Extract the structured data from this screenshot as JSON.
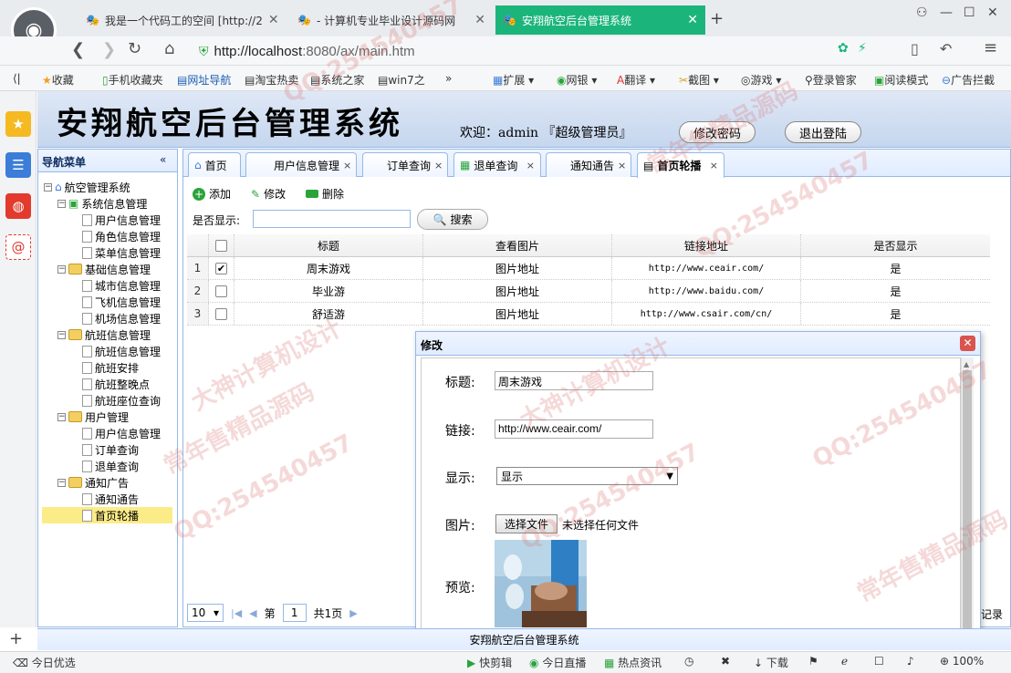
{
  "browser": {
    "tabs": [
      {
        "label": "我是一个代码工的空间 [http://2",
        "active": false
      },
      {
        "label": "- 计算机专业毕业设计源码网",
        "active": false
      },
      {
        "label": "安翔航空后台管理系统",
        "active": true
      }
    ],
    "new_tab": "+",
    "url_host": "http://localhost",
    "url_rest": ":8080/ax/main.htm",
    "bookmarks": [
      "收藏",
      "手机收藏夹",
      "网址导航",
      "淘宝热卖",
      "系统之家",
      "win7之",
      "扩展",
      "网银",
      "翻译",
      "截图",
      "游戏",
      "登录管家",
      "阅读模式",
      "广告拦截"
    ]
  },
  "app": {
    "title": "安翔航空后台管理系统",
    "welcome": "欢迎：admin 『超级管理员』",
    "change_password": "修改密码",
    "logout": "退出登陆",
    "footer": "安翔航空后台管理系统"
  },
  "nav": {
    "header": "导航菜单",
    "collapse": "«",
    "tree": [
      {
        "label": "航空管理系统",
        "level": 0,
        "type": "root"
      },
      {
        "label": "系统信息管理",
        "level": 1,
        "type": "group"
      },
      {
        "label": "用户信息管理",
        "level": 2,
        "type": "leaf"
      },
      {
        "label": "角色信息管理",
        "level": 2,
        "type": "leaf"
      },
      {
        "label": "菜单信息管理",
        "level": 2,
        "type": "leaf"
      },
      {
        "label": "基础信息管理",
        "level": 1,
        "type": "folder"
      },
      {
        "label": "城市信息管理",
        "level": 2,
        "type": "leaf"
      },
      {
        "label": "飞机信息管理",
        "level": 2,
        "type": "leaf"
      },
      {
        "label": "机场信息管理",
        "level": 2,
        "type": "leaf"
      },
      {
        "label": "航班信息管理",
        "level": 1,
        "type": "folder"
      },
      {
        "label": "航班信息管理",
        "level": 2,
        "type": "leaf"
      },
      {
        "label": "航班安排",
        "level": 2,
        "type": "leaf"
      },
      {
        "label": "航班整晚点",
        "level": 2,
        "type": "leaf"
      },
      {
        "label": "航班座位查询",
        "level": 2,
        "type": "leaf"
      },
      {
        "label": "用户管理",
        "level": 1,
        "type": "folder"
      },
      {
        "label": "用户信息管理",
        "level": 2,
        "type": "leaf"
      },
      {
        "label": "订单查询",
        "level": 2,
        "type": "leaf"
      },
      {
        "label": "退单查询",
        "level": 2,
        "type": "leaf"
      },
      {
        "label": "通知广告",
        "level": 1,
        "type": "folder"
      },
      {
        "label": "通知通告",
        "level": 2,
        "type": "leaf"
      },
      {
        "label": "首页轮播",
        "level": 2,
        "type": "leaf",
        "selected": true
      }
    ]
  },
  "page_tabs": [
    {
      "label": "首页",
      "closable": false
    },
    {
      "label": "用户信息管理",
      "closable": true
    },
    {
      "label": "订单查询",
      "closable": true
    },
    {
      "label": "退单查询",
      "closable": true
    },
    {
      "label": "通知通告",
      "closable": true
    },
    {
      "label": "首页轮播",
      "closable": true,
      "active": true
    }
  ],
  "toolbar": {
    "add": "添加",
    "edit": "修改",
    "delete": "删除"
  },
  "search": {
    "label": "是否显示:",
    "value": "",
    "button": "搜索"
  },
  "grid": {
    "columns": [
      "标题",
      "查看图片",
      "链接地址",
      "是否显示"
    ],
    "rows": [
      {
        "num": "1",
        "checked": true,
        "title": "周末游戏",
        "image": "图片地址",
        "link": "http://www.ceair.com/",
        "show": "是"
      },
      {
        "num": "2",
        "checked": false,
        "title": "毕业游",
        "image": "图片地址",
        "link": "http://www.baidu.com/",
        "show": "是"
      },
      {
        "num": "3",
        "checked": false,
        "title": "舒适游",
        "image": "图片地址",
        "link": "http://www.csair.com/cn/",
        "show": "是"
      }
    ]
  },
  "pager": {
    "page_size": "10",
    "page_prefix": "第",
    "page": "1",
    "total": "共1页",
    "record_text": "记录"
  },
  "dialog": {
    "title": "修改",
    "title_label": "标题:",
    "title_value": "周末游戏",
    "link_label": "链接:",
    "link_value": "http://www.ceair.com/",
    "show_label": "显示:",
    "show_value": "显示",
    "image_label": "图片:",
    "file_button": "选择文件",
    "file_status": "未选择任何文件",
    "preview_label": "预览:"
  },
  "status_bar": {
    "left": "今日优选",
    "items": [
      "快剪辑",
      "今日直播",
      "热点资讯",
      "下载",
      "100%"
    ]
  },
  "watermarks": [
    "QQ:254540457",
    "大神计算机设计",
    "常年售精品源码"
  ],
  "colors": {
    "accent_tab": "#1bb57c",
    "panel_border": "#95b8e7",
    "selected_node": "#fbec88"
  }
}
